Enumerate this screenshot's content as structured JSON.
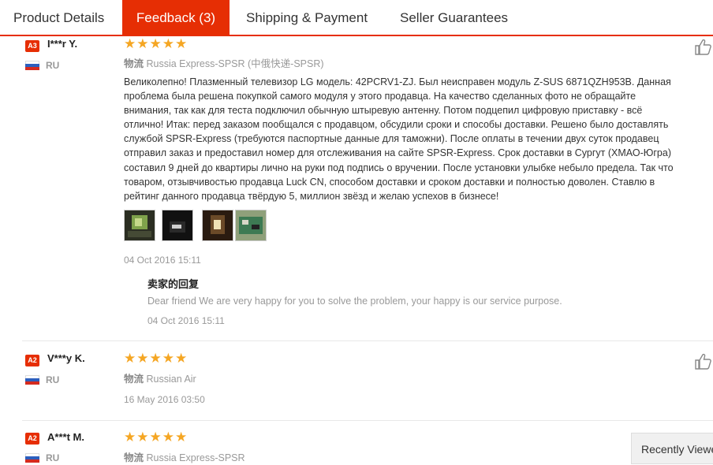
{
  "tabs": [
    {
      "label": "Product Details"
    },
    {
      "label": "Feedback (3)"
    },
    {
      "label": "Shipping & Payment"
    },
    {
      "label": "Seller Guarantees"
    }
  ],
  "colors": {
    "accent": "#e62e04",
    "star": "#f5a623",
    "muted": "#999999"
  },
  "reviews": [
    {
      "level": "A3",
      "user": "I***r Y.",
      "country": "RU",
      "stars": "★★★★★",
      "rating": 5,
      "logistics_cn": "物流",
      "logistics": "Russia Express-SPSR (中俄快递-SPSR)",
      "text": "Великолепно! Плазменный телевизор LG модель: 42PCRV1-ZJ. Был неисправен модуль Z-SUS 6871QZH953B. Данная\nпроблема была решена покупкой самого модуля у этого продавца. На качество сделанных фото не обращайте\nвнимания, так как для теста подключил обычную штыревую антенну. Потом подцепил цифровую приставку - всё\nотлично! Итак: перед заказом пообщался с продавцом, обсудили сроки и способы доставки. Решено было доставлять\nслужбой SPSR-Express (требуются паспортные данные для таможни). После оплаты в течении двух суток продавец\nотправил заказ и предоставил номер для отслеживания на сайте SPSR-Express. Срок доставки в Сургут (ХМАО-Югра)\nсоставил 9 дней до квартиры лично на руки под подпись о вручении. После установки улыбке небыло предела. Так что\nтоваром, отзывчивостью продавца Luck CN, способом доставки и сроком доставки и полностью доволен. Ставлю в\nрейтинг данного продавца твёрдую 5, миллион звёзд и желаю успехов в бизнесе!",
      "photos": [
        "photo-tv-screen",
        "photo-tv-dark",
        "photo-tv-glow",
        "photo-circuit-board"
      ],
      "date": "04 Oct 2016 15:11",
      "reply": {
        "title": "卖家的回复",
        "text": "Dear friend We are very happy for you to solve the problem, your happy is our service purpose.",
        "date": "04 Oct 2016 15:11"
      }
    },
    {
      "level": "A2",
      "user": "V***y K.",
      "country": "RU",
      "stars": "★★★★★",
      "rating": 5,
      "logistics_cn": "物流",
      "logistics": "Russian Air",
      "date": "16 May 2016 03:50"
    },
    {
      "level": "A2",
      "user": "A***t M.",
      "country": "RU",
      "stars": "★★★★★",
      "rating": 5,
      "logistics_cn": "物流",
      "logistics": "Russia Express-SPSR"
    }
  ],
  "recently_viewed": "Recently Viewed"
}
